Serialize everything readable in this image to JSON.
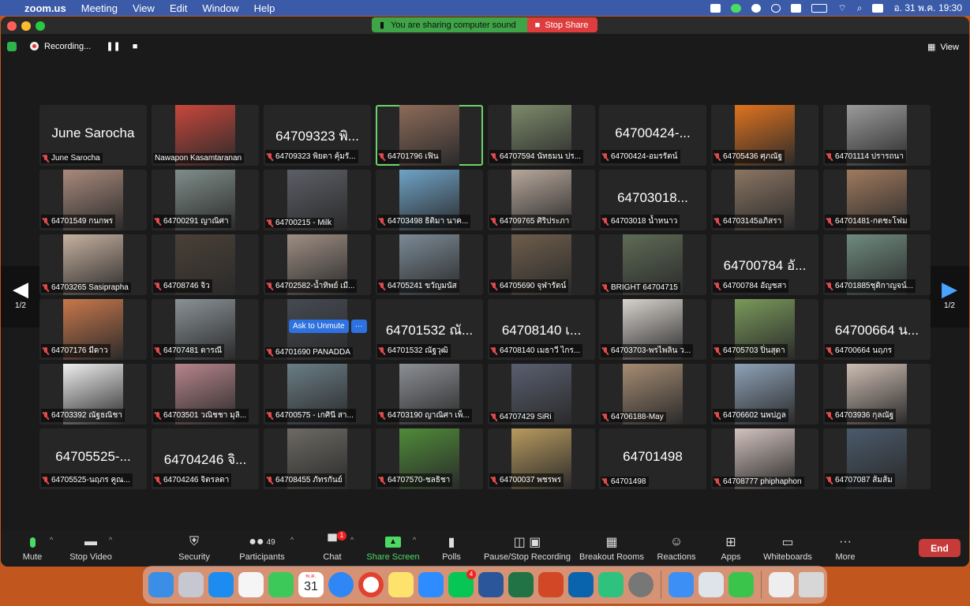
{
  "menubar": {
    "app": "zoom.us",
    "items": [
      "Meeting",
      "View",
      "Edit",
      "Window",
      "Help"
    ],
    "clock": "อ. 31 พ.ค.  19:30"
  },
  "banner": {
    "sharing_text": "You are sharing computer sound",
    "stop_label": "Stop Share"
  },
  "recording": {
    "label": "Recording..."
  },
  "view": {
    "label": "View"
  },
  "page_indicator": {
    "left": "1/2",
    "right": "1/2"
  },
  "ask": {
    "label": "Ask to Unmute",
    "more": "···"
  },
  "tiles": [
    {
      "big": "June Sarocha",
      "label": "June Sarocha",
      "color": "",
      "mute": true
    },
    {
      "big": "",
      "label": "Nawapon Kasamtaranan",
      "color": "#c8473c",
      "mute": false
    },
    {
      "big": "64709323 พิ...",
      "label": "64709323 พิยดา คุ้มรั...",
      "color": "",
      "mute": true
    },
    {
      "big": "",
      "label": "64701796 เฟิน",
      "color": "#8d6b5a",
      "mute": true,
      "active": true
    },
    {
      "big": "",
      "label": "64707594 นัทธมน ปร...",
      "color": "#7d8a6b",
      "mute": true
    },
    {
      "big": "64700424-...",
      "label": "64700424-อมรรัตน์",
      "color": "",
      "mute": true
    },
    {
      "big": "",
      "label": "64705436 ศุภณัฐ",
      "color": "#e0731f",
      "mute": true
    },
    {
      "big": "",
      "label": "64701114 ปรารถนา",
      "color": "#9b9b9b",
      "mute": true
    },
    {
      "big": "",
      "label": "64701549 กนกพร",
      "color": "#a98a7c",
      "mute": true
    },
    {
      "big": "",
      "label": "64700291 ญาณิศา",
      "color": "#7f8e8a",
      "mute": true
    },
    {
      "big": "",
      "label": "64700215 - Milk",
      "color": "#5c5f66",
      "mute": true
    },
    {
      "big": "",
      "label": "64703498 ธิติมา นาค...",
      "color": "#6fa3c7",
      "mute": true
    },
    {
      "big": "",
      "label": "64709765 ศิริประภา",
      "color": "#b7a79b",
      "mute": true
    },
    {
      "big": "64703018...",
      "label": "64703018 น้ำหนาว",
      "color": "",
      "mute": true
    },
    {
      "big": "",
      "label": "64703145อภิสรา",
      "color": "#8b7563",
      "mute": true
    },
    {
      "big": "",
      "label": "64701481-กตชะโฟม",
      "color": "#a07a5e",
      "mute": true
    },
    {
      "big": "",
      "label": "64703265 Sasiprapha",
      "color": "#c7b1a0",
      "mute": true
    },
    {
      "big": "",
      "label": "64708746 จิว",
      "color": "#4a4036",
      "mute": true
    },
    {
      "big": "",
      "label": "64702582-น้ำทิพย์ เมื...",
      "color": "#9e8e83",
      "mute": true
    },
    {
      "big": "",
      "label": "64705241 ขวัญมนัส",
      "color": "#7b8a96",
      "mute": true
    },
    {
      "big": "",
      "label": "64705690 จุฬารัตน์",
      "color": "#6e5d4c",
      "mute": true
    },
    {
      "big": "",
      "label": "BRIGHT 64704715",
      "color": "#5f6b56",
      "mute": true
    },
    {
      "big": "64700784 อั...",
      "label": "64700784 อัญชสา",
      "color": "",
      "mute": true
    },
    {
      "big": "",
      "label": "64701885ชุติกาญจน์...",
      "color": "#6f8b7f",
      "mute": true
    },
    {
      "big": "",
      "label": "64707176 มีดาว",
      "color": "#c9784b",
      "mute": true
    },
    {
      "big": "",
      "label": "64707481 ดารณี",
      "color": "#8a9296",
      "mute": true
    },
    {
      "big": "",
      "label": "64701690 PANADDA",
      "color": "#454a52",
      "mute": true
    },
    {
      "big": "64701532 ณั...",
      "label": "64701532 ณัฐวุฒิ",
      "color": "",
      "mute": true
    },
    {
      "big": "64708140 เ...",
      "label": "64708140 เมธาวี ไกร...",
      "color": "",
      "mute": true
    },
    {
      "big": "",
      "label": "64703703-พรไพลิน ว...",
      "color": "#d7d2cd",
      "mute": true
    },
    {
      "big": "",
      "label": "64705703 ปิ่นสุดา",
      "color": "#7a9a5a",
      "mute": true
    },
    {
      "big": "64700664 น...",
      "label": "64700664 นฤภร",
      "color": "",
      "mute": true
    },
    {
      "big": "",
      "label": "64703392 ณัฐธณิชา",
      "color": "#eeeeee",
      "mute": true
    },
    {
      "big": "",
      "label": "64703501 วณิชชา มุลิ...",
      "color": "#b6858b",
      "mute": true
    },
    {
      "big": "",
      "label": "64700575 - เกศินี สา...",
      "color": "#6a7d86",
      "mute": true
    },
    {
      "big": "",
      "label": "64703190 ญาณิศา เพ็...",
      "color": "#8c8f94",
      "mute": true
    },
    {
      "big": "",
      "label": "64707429 SiRi",
      "color": "#5a5f70",
      "mute": true
    },
    {
      "big": "",
      "label": "64706188-May",
      "color": "#a68c73",
      "mute": true
    },
    {
      "big": "",
      "label": "64706602 นพปฎล",
      "color": "#8ea2b7",
      "mute": true
    },
    {
      "big": "",
      "label": "64703936 กุลณัฐ",
      "color": "#cdbdb2",
      "mute": true
    },
    {
      "big": "64705525-...",
      "label": "64705525-นฤภร คูณ...",
      "color": "",
      "mute": true
    },
    {
      "big": "64704246 จิ...",
      "label": "64704246 จิตรลดา",
      "color": "",
      "mute": true
    },
    {
      "big": "",
      "label": "64708455 ภัทรกันย์",
      "color": "#6d6a64",
      "mute": true
    },
    {
      "big": "",
      "label": "64707570-ชลธิชา",
      "color": "#4f8b39",
      "mute": true
    },
    {
      "big": "",
      "label": "64700037 พชรพร",
      "color": "#b89a5e",
      "mute": true
    },
    {
      "big": "64701498",
      "label": "64701498",
      "color": "",
      "mute": true
    },
    {
      "big": "",
      "label": "64708777 phiphaphon",
      "color": "#d2c2bd",
      "mute": true
    },
    {
      "big": "",
      "label": "64707087 ส้มส้ม",
      "color": "#4a5a6b",
      "mute": true
    }
  ],
  "toolbar": {
    "mute": "Mute",
    "stop_video": "Stop Video",
    "security": "Security",
    "participants": "Participants",
    "participants_count": "49",
    "chat": "Chat",
    "chat_badge": "1",
    "share": "Share Screen",
    "polls": "Polls",
    "recording": "Pause/Stop Recording",
    "breakout": "Breakout Rooms",
    "reactions": "Reactions",
    "apps": "Apps",
    "whiteboards": "Whiteboards",
    "more": "More",
    "end": "End"
  },
  "dock": {
    "calendar_month": "พ.ค.",
    "calendar_day": "31",
    "line_badge": "4"
  }
}
